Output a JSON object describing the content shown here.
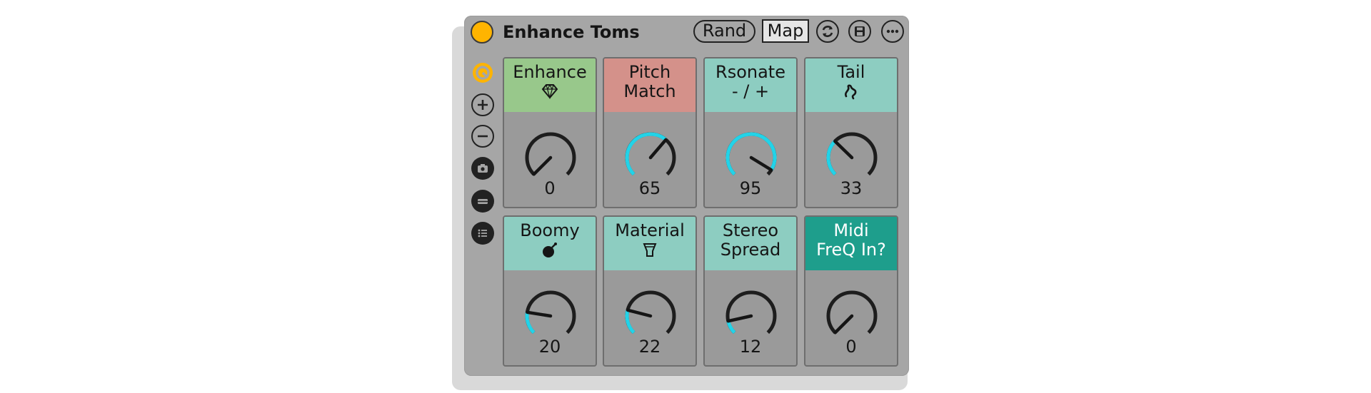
{
  "device": {
    "title": "Enhance Toms",
    "rand_label": "Rand",
    "map_label": "Map"
  },
  "titlebar_icons": [
    "refresh-icon",
    "save-icon",
    "more-icon"
  ],
  "sidebar_icons": [
    "hot-swap-icon",
    "add-icon",
    "remove-icon",
    "camera-icon",
    "minimize-icon",
    "list-icon"
  ],
  "macros": [
    {
      "title": "Enhance",
      "icon": "diamond-icon",
      "header_color": "#98c88b",
      "value": 0
    },
    {
      "title": "Pitch\nMatch",
      "icon": "",
      "header_color": "#d4918a",
      "value": 65
    },
    {
      "title": "Rsonate\n- / +",
      "icon": "",
      "header_color": "#8dcdc1",
      "value": 95
    },
    {
      "title": "Tail",
      "icon": "squiggle-icon",
      "header_color": "#8dcdc1",
      "value": 33
    },
    {
      "title": "Boomy",
      "icon": "bomb-icon",
      "header_color": "#8dcdc1",
      "value": 20
    },
    {
      "title": "Material",
      "icon": "drum-icon",
      "header_color": "#8dcdc1",
      "value": 22
    },
    {
      "title": "Stereo\nSpread",
      "icon": "",
      "header_color": "#8dcdc1",
      "value": 12
    },
    {
      "title": "Midi\nFreQ In?",
      "icon": "",
      "header_color": "#1e9e8c",
      "value": 0
    }
  ],
  "colors": {
    "accent": "#ffb400",
    "knob_arc": "#22d3e8",
    "knob_track": "#1d1d1d"
  }
}
